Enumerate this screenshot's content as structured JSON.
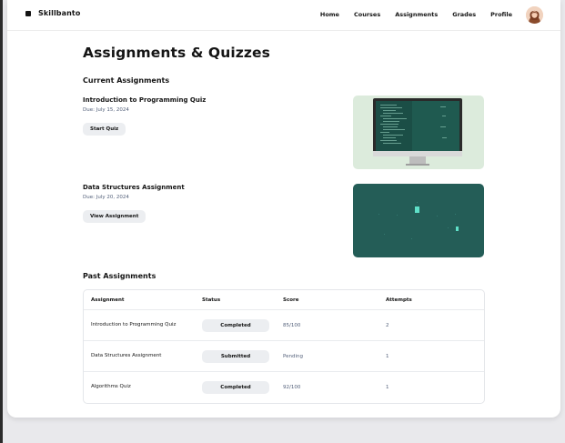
{
  "brand": {
    "name": "Skillbanto"
  },
  "nav": {
    "items": [
      {
        "label": "Home"
      },
      {
        "label": "Courses"
      },
      {
        "label": "Assignments"
      },
      {
        "label": "Grades"
      },
      {
        "label": "Profile"
      }
    ]
  },
  "page": {
    "title": "Assignments & Quizzes"
  },
  "current": {
    "heading": "Current Assignments",
    "items": [
      {
        "title": "Introduction to Programming Quiz",
        "due": "Due: July 15, 2024",
        "action": "Start Quiz",
        "thumb_bg": "#dcebdc"
      },
      {
        "title": "Data Structures Assignment",
        "due": "Due: July 20, 2024",
        "action": "View Assignment",
        "thumb_bg": "#245d57"
      }
    ]
  },
  "past": {
    "heading": "Past Assignments",
    "columns": [
      "Assignment",
      "Status",
      "Score",
      "Attempts"
    ],
    "rows": [
      {
        "assignment": "Introduction to Programming Quiz",
        "status": "Completed",
        "score": "85/100",
        "attempts": "2"
      },
      {
        "assignment": "Data Structures Assignment",
        "status": "Submitted",
        "score": "Pending",
        "attempts": "1"
      },
      {
        "assignment": "Algorithms Quiz",
        "status": "Completed",
        "score": "92/100",
        "attempts": "1"
      }
    ]
  },
  "colors": {
    "accent_text": "#53607a",
    "pill_bg": "#eceef1",
    "thumb_green": "#245d57",
    "thumb_mint": "#dcebdc"
  },
  "icons": {
    "avatar": "user-avatar-icon",
    "logo": "logo-square-icon"
  }
}
